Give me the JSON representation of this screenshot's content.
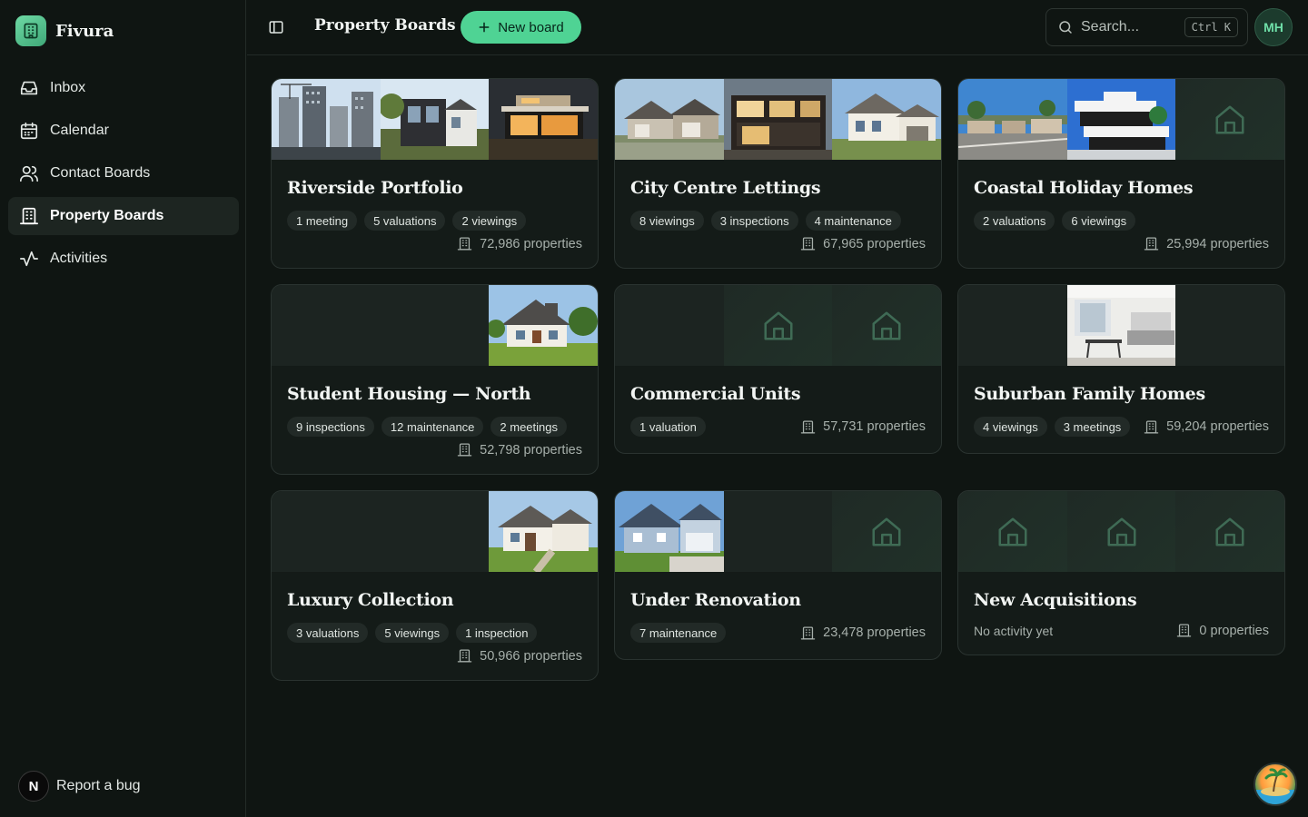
{
  "brand": {
    "name": "Fivura"
  },
  "sidebar": {
    "items": [
      {
        "label": "Inbox",
        "icon": "inbox-icon",
        "active": false
      },
      {
        "label": "Calendar",
        "icon": "calendar-icon",
        "active": false
      },
      {
        "label": "Contact Boards",
        "icon": "users-icon",
        "active": false
      },
      {
        "label": "Property Boards",
        "icon": "building-icon",
        "active": true
      },
      {
        "label": "Activities",
        "icon": "activity-icon",
        "active": false
      }
    ],
    "report_bug": "Report a bug",
    "dev_badge": "N"
  },
  "header": {
    "title": "Property Boards",
    "new_board_label": "New board",
    "search_placeholder": "Search...",
    "search_shortcut": "Ctrl K",
    "avatar_initials": "MH"
  },
  "colors": {
    "accent": "#4fd394",
    "background": "#0f1512",
    "card": "#141b18"
  },
  "boards": [
    {
      "title": "Riverside Portfolio",
      "chips": [
        "1 meeting",
        "5 valuations",
        "2 viewings"
      ],
      "properties": "72,986 properties",
      "thumbs": [
        "photo-towers",
        "photo-modern",
        "photo-villa"
      ],
      "props_inline": false
    },
    {
      "title": "City Centre Lettings",
      "chips": [
        "8 viewings",
        "3 inspections",
        "4 maintenance"
      ],
      "properties": "67,965 properties",
      "thumbs": [
        "photo-suburban",
        "photo-darkhouse",
        "photo-whitehouse"
      ],
      "props_inline": false
    },
    {
      "title": "Coastal Holiday Homes",
      "chips": [
        "2 valuations",
        "6 viewings"
      ],
      "properties": "25,994 properties",
      "thumbs": [
        "photo-street",
        "photo-beachvilla",
        "placeholder"
      ],
      "props_inline": false
    },
    {
      "title": "Student Housing — North",
      "chips": [
        "9 inspections",
        "12 maintenance",
        "2 meetings"
      ],
      "properties": "52,798 properties",
      "thumbs": [
        "empty",
        "empty",
        "photo-cottage"
      ],
      "props_inline": false
    },
    {
      "title": "Commercial Units",
      "chips": [
        "1 valuation"
      ],
      "properties": "57,731 properties",
      "thumbs": [
        "empty",
        "placeholder",
        "placeholder"
      ],
      "props_inline": true
    },
    {
      "title": "Suburban Family Homes",
      "chips": [
        "4 viewings",
        "3 meetings"
      ],
      "properties": "59,204 properties",
      "thumbs": [
        "empty",
        "photo-interior",
        "empty"
      ],
      "props_inline": true
    },
    {
      "title": "Luxury Collection",
      "chips": [
        "3 valuations",
        "5 viewings",
        "1 inspection"
      ],
      "properties": "50,966 properties",
      "thumbs": [
        "empty",
        "empty",
        "photo-luxury"
      ],
      "props_inline": false
    },
    {
      "title": "Under Renovation",
      "chips": [
        "7 maintenance"
      ],
      "properties": "23,478 properties",
      "thumbs": [
        "photo-bluehouse",
        "empty",
        "placeholder"
      ],
      "props_inline": true
    },
    {
      "title": "New Acquisitions",
      "chips": [],
      "no_activity": "No activity yet",
      "properties": "0 properties",
      "thumbs": [
        "placeholder",
        "placeholder",
        "placeholder"
      ],
      "props_inline": true
    }
  ]
}
